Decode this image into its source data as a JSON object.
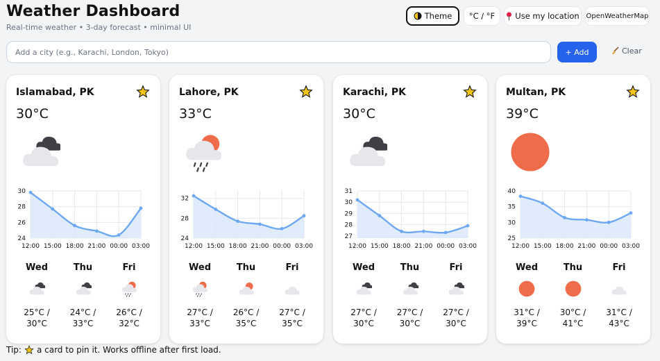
{
  "header": {
    "title": "Weather Dashboard",
    "subtitle": "Real-time weather • 3-day forecast • minimal UI"
  },
  "toolbar": {
    "theme_label": "Theme",
    "units_label": "°C / °F",
    "location_label": "Use my location",
    "provider_label": "OpenWeatherMap"
  },
  "search": {
    "placeholder": "Add a city (e.g., Karachi, London, Tokyo)",
    "value": "",
    "add_label": "+ Add",
    "clear_label": "Clear"
  },
  "colors": {
    "accent": "#2563eb",
    "line": "#6ea8f0",
    "fill": "#dbe9fb",
    "sun": "#ef6c4a",
    "cloud": "#e5e7eb",
    "dark_cloud": "#3f3f46",
    "star": "#f5c518"
  },
  "times": [
    "12:00",
    "15:00",
    "18:00",
    "21:00",
    "00:00",
    "03:00"
  ],
  "cards": [
    {
      "city": "Islamabad, PK",
      "temp": "30°C",
      "icon": "cloud-dark-icon",
      "pinned": false,
      "ticks": [
        "30",
        "28",
        "26",
        "24"
      ],
      "ymin": 24,
      "ymax": 30,
      "series": [
        29.8,
        27.7,
        25.6,
        24.9,
        24.4,
        27.8
      ],
      "days": [
        {
          "name": "Wed",
          "range_low": "25°C /",
          "range_high": "30°C",
          "icon": "cloud-dark-icon"
        },
        {
          "name": "Thu",
          "range_low": "24°C /",
          "range_high": "33°C",
          "icon": "cloud-dark-icon"
        },
        {
          "name": "Fri",
          "range_low": "26°C /",
          "range_high": "32°C",
          "icon": "rain-sun-icon"
        }
      ]
    },
    {
      "city": "Lahore, PK",
      "temp": "33°C",
      "icon": "rain-sun-icon",
      "pinned": false,
      "ticks": [
        "32",
        "28",
        "24"
      ],
      "ymin": 24,
      "ymax": 33.5,
      "series": [
        32.5,
        29.8,
        27.4,
        26.8,
        25.9,
        28.5
      ],
      "days": [
        {
          "name": "Wed",
          "range_low": "27°C /",
          "range_high": "33°C",
          "icon": "rain-sun-icon"
        },
        {
          "name": "Thu",
          "range_low": "26°C /",
          "range_high": "35°C",
          "icon": "cloud-sun-icon"
        },
        {
          "name": "Fri",
          "range_low": "27°C /",
          "range_high": "35°C",
          "icon": "cloud-icon"
        }
      ]
    },
    {
      "city": "Karachi, PK",
      "temp": "30°C",
      "icon": "cloud-dark-icon",
      "pinned": false,
      "ticks": [
        "31",
        "30",
        "29",
        "28",
        "27"
      ],
      "ymin": 26.8,
      "ymax": 31,
      "series": [
        30.2,
        28.8,
        27.4,
        27.4,
        27.3,
        27.9
      ],
      "days": [
        {
          "name": "Wed",
          "range_low": "27°C /",
          "range_high": "30°C",
          "icon": "cloud-dark-icon"
        },
        {
          "name": "Thu",
          "range_low": "27°C /",
          "range_high": "30°C",
          "icon": "cloud-dark-icon"
        },
        {
          "name": "Fri",
          "range_low": "27°C /",
          "range_high": "30°C",
          "icon": "cloud-dark-icon"
        }
      ]
    },
    {
      "city": "Multan, PK",
      "temp": "39°C",
      "icon": "sun-icon",
      "pinned": false,
      "ticks": [
        "40",
        "35",
        "30",
        "25"
      ],
      "ymin": 25,
      "ymax": 40,
      "series": [
        38.3,
        36.1,
        31.5,
        30.8,
        30.0,
        33.0
      ],
      "days": [
        {
          "name": "Wed",
          "range_low": "31°C /",
          "range_high": "39°C",
          "icon": "sun-icon"
        },
        {
          "name": "Thu",
          "range_low": "30°C /",
          "range_high": "41°C",
          "icon": "sun-icon"
        },
        {
          "name": "Fri",
          "range_low": "31°C /",
          "range_high": "43°C",
          "icon": "cloud-icon"
        }
      ]
    }
  ],
  "tip": {
    "before": "Tip:",
    "after": "a card to pin it. Works offline after first load."
  }
}
